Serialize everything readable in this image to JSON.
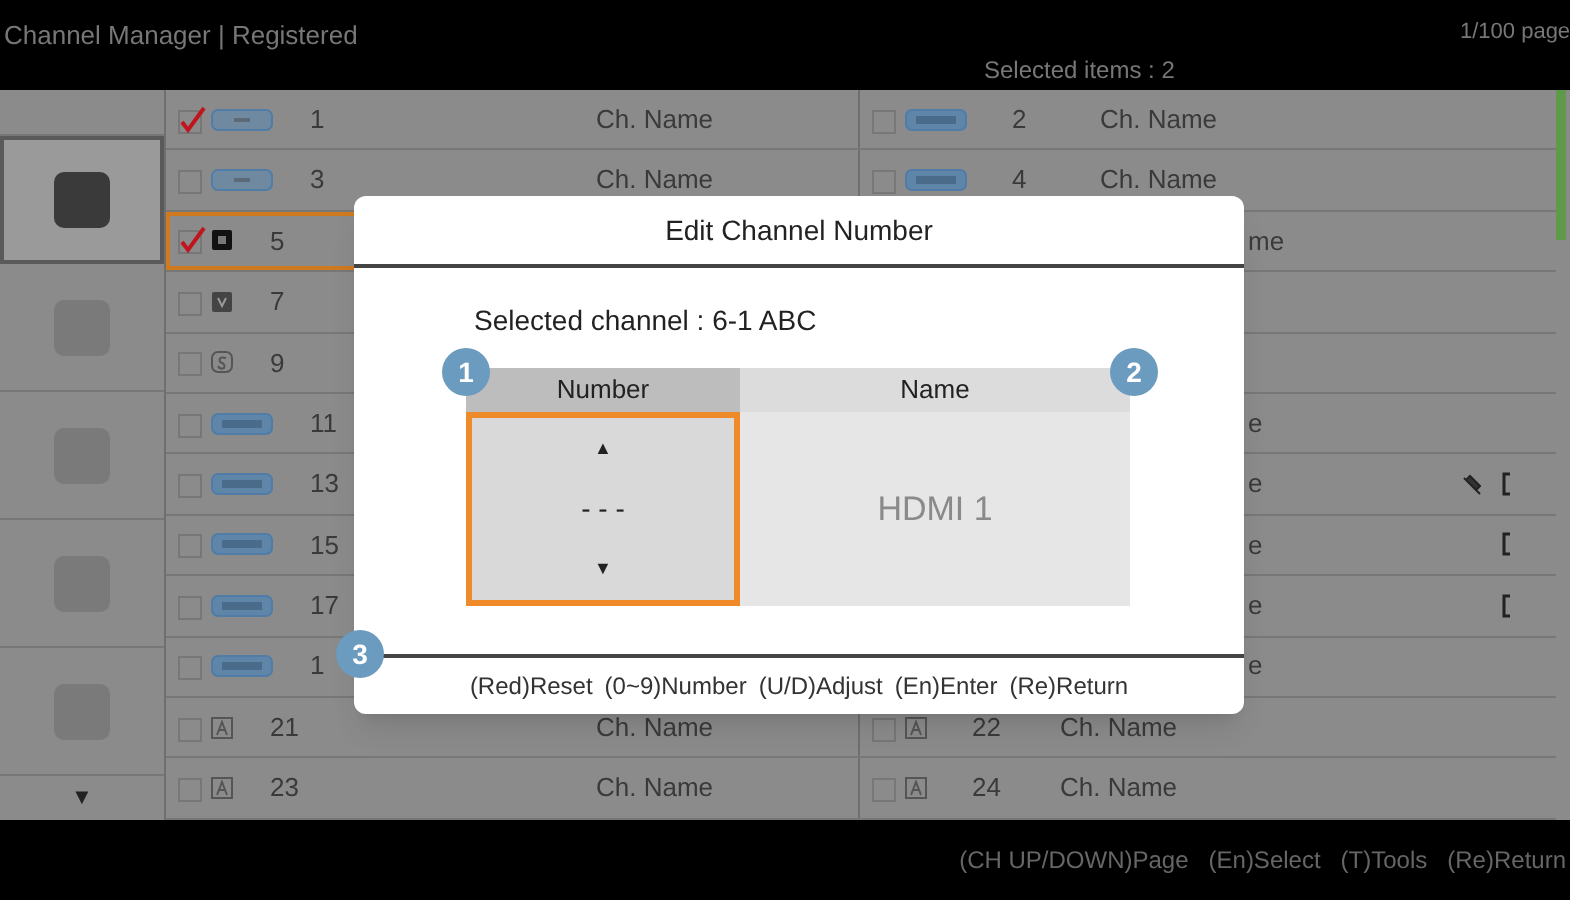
{
  "header": {
    "title": "Channel Manager | Registered",
    "selected_count": "Selected items : 2",
    "page": "1/100 page"
  },
  "categories": [
    {
      "selected": true
    },
    {
      "selected": false
    },
    {
      "selected": false
    },
    {
      "selected": false
    },
    {
      "selected": false
    }
  ],
  "scroll_down": "▼",
  "rows": [
    {
      "left": {
        "checked": true,
        "badge": {
          "kind": "pill"
        },
        "number": "1",
        "name": "Ch. Name",
        "focused": false
      },
      "right": {
        "kind": "full",
        "checked": false,
        "badge": {
          "kind": "wide"
        },
        "number": "2",
        "name": "Ch. Name"
      }
    },
    {
      "left": {
        "checked": false,
        "badge": {
          "kind": "pill"
        },
        "number": "3",
        "name": "Ch. Name",
        "focused": false
      },
      "right": {
        "kind": "full",
        "checked": false,
        "badge": {
          "kind": "wide"
        },
        "number": "4",
        "name": "Ch. Name"
      }
    },
    {
      "left": {
        "checked": true,
        "badge": {
          "kind": "dark"
        },
        "number": "5",
        "focused": true
      },
      "right": {
        "kind": "cut",
        "text": "me"
      }
    },
    {
      "left": {
        "checked": false,
        "badge": {
          "kind": "v"
        },
        "number": "7",
        "focused": false
      },
      "right": {
        "kind": "hidden"
      }
    },
    {
      "left": {
        "checked": false,
        "badge": {
          "kind": "s"
        },
        "number": "9",
        "focused": false
      },
      "right": {
        "kind": "hidden"
      }
    },
    {
      "left": {
        "checked": false,
        "badge": {
          "kind": "wide"
        },
        "number": "11",
        "focused": false
      },
      "right": {
        "kind": "cut",
        "text": "e"
      }
    },
    {
      "left": {
        "checked": false,
        "badge": {
          "kind": "wide"
        },
        "number": "13",
        "focused": false
      },
      "right": {
        "kind": "cut",
        "text": "e",
        "icons": [
          {
            "kind": "crossed"
          },
          {
            "kind": "bracket"
          }
        ]
      }
    },
    {
      "left": {
        "checked": false,
        "badge": {
          "kind": "wide"
        },
        "number": "15",
        "focused": false
      },
      "right": {
        "kind": "cut",
        "text": "e",
        "icons": [
          {
            "kind": "bracket"
          }
        ]
      }
    },
    {
      "left": {
        "checked": false,
        "badge": {
          "kind": "wide"
        },
        "number": "17",
        "focused": false
      },
      "right": {
        "kind": "cut",
        "text": "e",
        "icons": [
          {
            "kind": "bracket"
          }
        ]
      }
    },
    {
      "left": {
        "checked": false,
        "badge": {
          "kind": "wide"
        },
        "number": "1",
        "focused": false
      },
      "right": {
        "kind": "cut",
        "text": "e"
      }
    },
    {
      "left": {
        "checked": false,
        "badge": {
          "kind": "a"
        },
        "number": "21",
        "name": "Ch. Name",
        "focused": false
      },
      "right": {
        "kind": "full",
        "checked": false,
        "badge": {
          "kind": "a"
        },
        "number": "22",
        "name": "Ch. Name"
      }
    },
    {
      "left": {
        "checked": false,
        "badge": {
          "kind": "a"
        },
        "number": "23",
        "name": "Ch. Name",
        "focused": false
      },
      "right": {
        "kind": "full",
        "checked": false,
        "badge": {
          "kind": "a"
        },
        "number": "24",
        "name": "Ch. Name"
      }
    }
  ],
  "dialog": {
    "title": "Edit Channel Number",
    "selected_channel": "Selected channel : 6-1 ABC",
    "columns": [
      "Number",
      "Name"
    ],
    "up": "▲",
    "value": "- - -",
    "down": "▼",
    "name": "HDMI 1",
    "markers": [
      "1",
      "2",
      "3"
    ],
    "hints": [
      "(Red)Reset",
      "(0~9)Number",
      "(U/D)Adjust",
      "(En)Enter",
      "(Re)Return"
    ]
  },
  "footer_hints": [
    "(CH UP/DOWN)Page",
    "(En)Select",
    "(T)Tools",
    "(Re)Return"
  ]
}
